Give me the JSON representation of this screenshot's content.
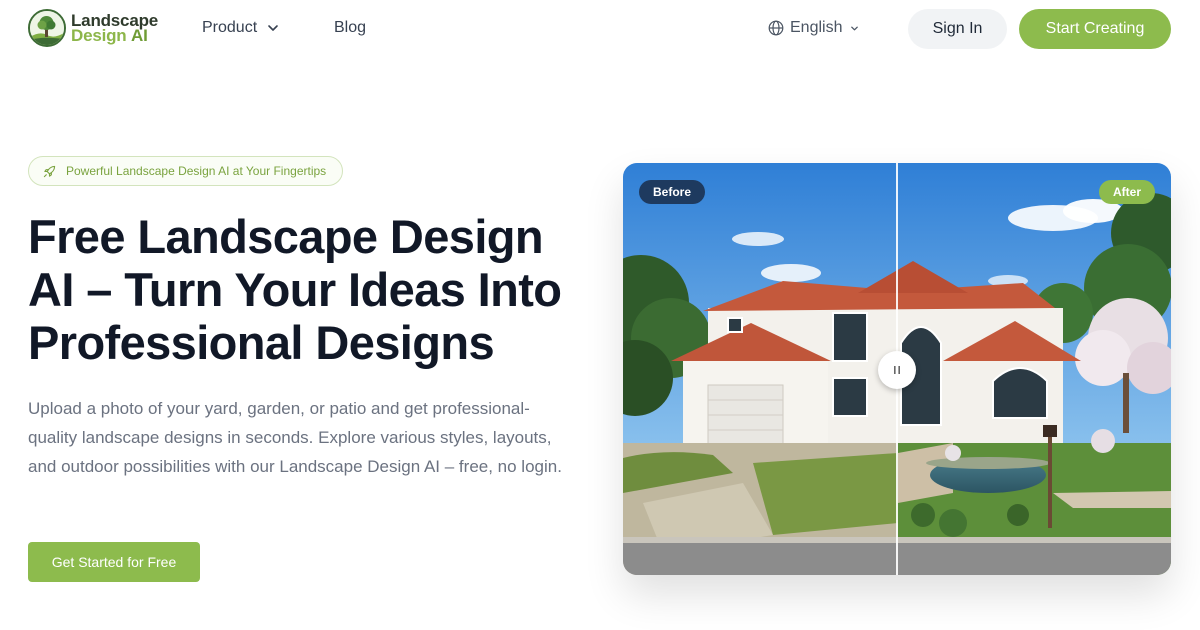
{
  "brand": {
    "line1": "Landscape",
    "line2": "Design",
    "line2_accent": "AI",
    "accent_color": "#8dbb4d",
    "dark_color": "#1e3a5f"
  },
  "nav": {
    "product_label": "Product",
    "blog_label": "Blog",
    "language_label": "English",
    "signin_label": "Sign In",
    "start_label": "Start Creating"
  },
  "hero": {
    "pill_icon": "rocket-icon",
    "pill_text": "Powerful Landscape Design AI at Your Fingertips",
    "title": "Free Landscape Design AI – Turn Your Ideas Into Professional Designs",
    "description": "Upload a photo of your yard, garden, or patio and get professional-quality landscape designs in seconds. Explore various styles, layouts, and outdoor possibilities with our Landscape Design AI – free, no login.",
    "cta_label": "Get Started for Free"
  },
  "compare": {
    "before_label": "Before",
    "after_label": "After",
    "handle_icon": "pause-grip-icon",
    "split_position": 0.5
  }
}
